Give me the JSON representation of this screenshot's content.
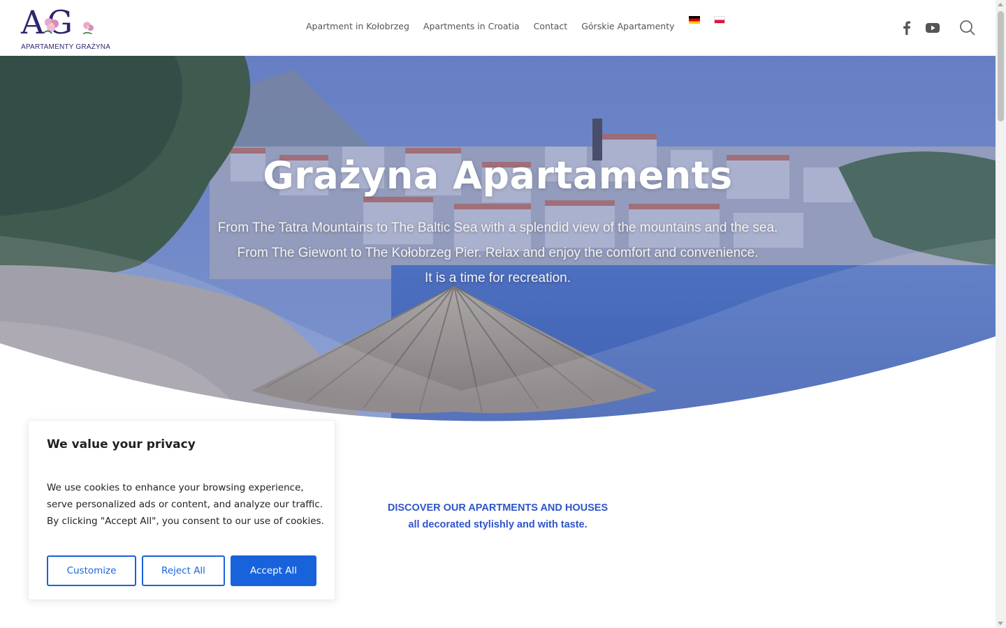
{
  "header": {
    "logo_monogram": "AG",
    "logo_text": "APARTAMENTY GRAŻYNA",
    "nav": [
      {
        "label": "Apartment in Kołobrzeg"
      },
      {
        "label": "Apartments in Croatia"
      },
      {
        "label": "Contact"
      },
      {
        "label": "Górskie Apartamenty"
      }
    ],
    "flags": [
      "german-flag-icon",
      "polish-flag-icon"
    ],
    "social_icons": [
      "facebook-icon",
      "youtube-icon",
      "search-icon"
    ]
  },
  "hero": {
    "title": "Grażyna Apartaments",
    "lines": [
      "From The Tatra Mountains to The Baltic Sea with a splendid view of the mountains and the sea.",
      "From The Giewont to The Kołobrzeg Pier. Relax and enjoy the comfort and convenience.",
      "It is a time for recreation."
    ]
  },
  "discover": {
    "line1": "DISCOVER OUR APARTMENTS AND HOUSES",
    "line2": "all decorated stylishly and with taste."
  },
  "cookie": {
    "title": "We value your privacy",
    "text": "We use cookies to enhance your browsing experience, serve personalized ads or content, and analyze our traffic. By clicking \"Accept All\", you consent to our use of cookies.",
    "customize": "Customize",
    "reject": "Reject All",
    "accept": "Accept All"
  },
  "colors": {
    "accent": "#1863dc",
    "discover_text": "#2e55c9",
    "logo": "#2f2470"
  }
}
